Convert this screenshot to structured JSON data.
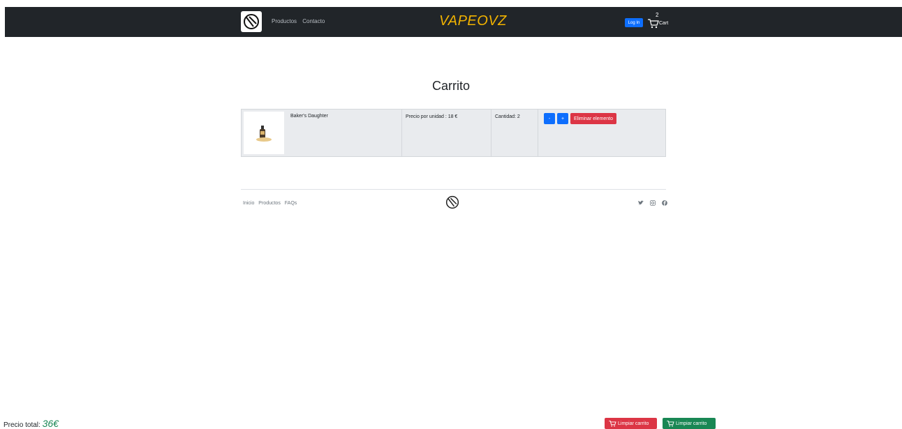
{
  "navbar": {
    "logo_icon": "vape-logo-icon",
    "links": [
      "Productos",
      "Contacto"
    ],
    "brand": "VAPEOVZ",
    "brand_color": "#f2b300",
    "login_label": "Log In",
    "cart_count": "2",
    "cart_label": "Cart"
  },
  "main": {
    "title": "Carrito",
    "items": [
      {
        "name": "Baker's Daughter",
        "price": "Precio por unidad : 18 €",
        "quantity": "Cantidad: 2",
        "decrement_label": "-",
        "increment_label": "+",
        "remove_label": "Eliminar elemento"
      }
    ]
  },
  "footer": {
    "links": [
      "Inicio",
      "Productos",
      "FAQs"
    ],
    "social_icons": [
      "twitter-icon",
      "instagram-icon",
      "facebook-icon"
    ]
  },
  "bottom": {
    "total_label": "Precio total:",
    "total_value": "36€",
    "clear_red_label": "Limpiar carrito",
    "clear_green_label": "Limpiar carrito"
  },
  "colors": {
    "primary": "#0d6efd",
    "danger": "#dc3545",
    "success": "#198754",
    "navbar_bg": "#212529"
  }
}
